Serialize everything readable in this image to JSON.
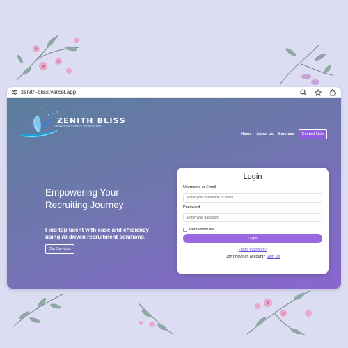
{
  "browser": {
    "url": "zenith-bliss.vercel.app",
    "icons": [
      "tune-icon",
      "zoom-icon",
      "bookmark-star-icon",
      "extensions-icon"
    ]
  },
  "brand": {
    "name": "ZENITH BLISS",
    "tagline": "Discover the Pinnacle of Recruitment"
  },
  "nav": {
    "links": [
      "Home",
      "About Us",
      "Services"
    ],
    "cta": "Contact Now"
  },
  "hero": {
    "title": "Empowering Your Recruiting Journey",
    "subtitle": "Find top talent with ease and efficiency using AI-driven recruitment solutions.",
    "button": "Our Services"
  },
  "login": {
    "title": "Login",
    "username_label": "Username or Email",
    "username_placeholder": "Enter your username or email",
    "password_label": "Password",
    "password_placeholder": "Enter your password",
    "remember_label": "Remember Me",
    "submit": "Login",
    "forgot": "Forgot Password?",
    "no_account": "Don't have an account?",
    "signup": "Sign Up"
  },
  "colors": {
    "page_bg": "#dcdcf2",
    "gradient_start": "#5b7e9c",
    "gradient_end": "#8a66cf",
    "accent": "#9a68e0",
    "link": "#6a4adf"
  }
}
